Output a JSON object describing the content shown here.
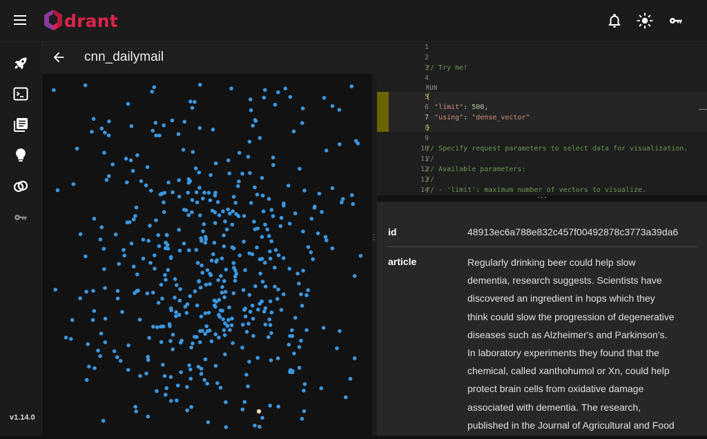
{
  "header": {
    "logo_text": "drant",
    "icons": [
      "menu-icon",
      "bell-icon",
      "theme-sun-icon",
      "key-icon"
    ]
  },
  "sidebar": {
    "items": [
      {
        "icon": "rocket-icon"
      },
      {
        "icon": "console-icon"
      },
      {
        "icon": "collections-icon"
      },
      {
        "icon": "lightbulb-icon"
      },
      {
        "icon": "rings-icon"
      },
      {
        "icon": "key-icon"
      }
    ],
    "version": "v1.14.0"
  },
  "visualize": {
    "collection_name": "cnn_dailymail"
  },
  "editor": {
    "lines": [
      {
        "n": "1",
        "tokens": []
      },
      {
        "n": "2",
        "tokens": []
      },
      {
        "n": "3",
        "tokens": [
          {
            "t": "// Try me!",
            "c": "comment"
          }
        ]
      },
      {
        "n": "4",
        "tokens": []
      },
      {
        "n": "",
        "tokens": [
          {
            "t": "RUN",
            "c": "run"
          }
        ]
      },
      {
        "n": "5",
        "tokens": [
          {
            "t": "{",
            "c": "brace"
          }
        ]
      },
      {
        "n": "6",
        "tokens": [
          {
            "t": "  ",
            "c": "punc"
          },
          {
            "t": "\"limit\"",
            "c": "key"
          },
          {
            "t": ": ",
            "c": "punc"
          },
          {
            "t": "500",
            "c": "num"
          },
          {
            "t": ",",
            "c": "punc"
          }
        ]
      },
      {
        "n": "7",
        "tokens": [
          {
            "t": "  ",
            "c": "punc"
          },
          {
            "t": "\"using\"",
            "c": "key"
          },
          {
            "t": ": ",
            "c": "punc"
          },
          {
            "t": "\"dense_vector\"",
            "c": "str"
          }
        ]
      },
      {
        "n": "8",
        "tokens": [
          {
            "t": "}",
            "c": "brace"
          }
        ]
      },
      {
        "n": "9",
        "tokens": []
      },
      {
        "n": "10",
        "tokens": [
          {
            "t": "// Specify request parameters to select data for visualization.",
            "c": "comment"
          }
        ]
      },
      {
        "n": "11",
        "tokens": [
          {
            "t": "//",
            "c": "comment"
          }
        ]
      },
      {
        "n": "12",
        "tokens": [
          {
            "t": "// Available parameters:",
            "c": "comment"
          }
        ]
      },
      {
        "n": "13",
        "tokens": [
          {
            "t": "//",
            "c": "comment"
          }
        ]
      },
      {
        "n": "14",
        "tokens": [
          {
            "t": "// - 'limit': maximum number of vectors to visualize.",
            "c": "comment"
          }
        ]
      }
    ]
  },
  "point_details": {
    "id_key": "id",
    "id_value": "48913ec6a788e832c457f00492878c3773a39da6",
    "article_key": "article",
    "article_lines": [
      "Regularly drinking beer could help slow",
      "dementia, research suggests. Scientists have",
      "discovered an ingredient in hops which they",
      "think could slow the progression of degenerative",
      "diseases such as Alzheimer's and Parkinson's.",
      "In laboratory experiments they found that the",
      "chemical, called xanthohumol or Xn, could help",
      "protect brain cells from oxidative damage",
      "associated with dementia. The research,",
      "published in the Journal of Agricultural and Food"
    ]
  },
  "colors": {
    "brand": "#dc244c",
    "point": "#3b97e0",
    "point_highlight": "#f3d9b0"
  }
}
